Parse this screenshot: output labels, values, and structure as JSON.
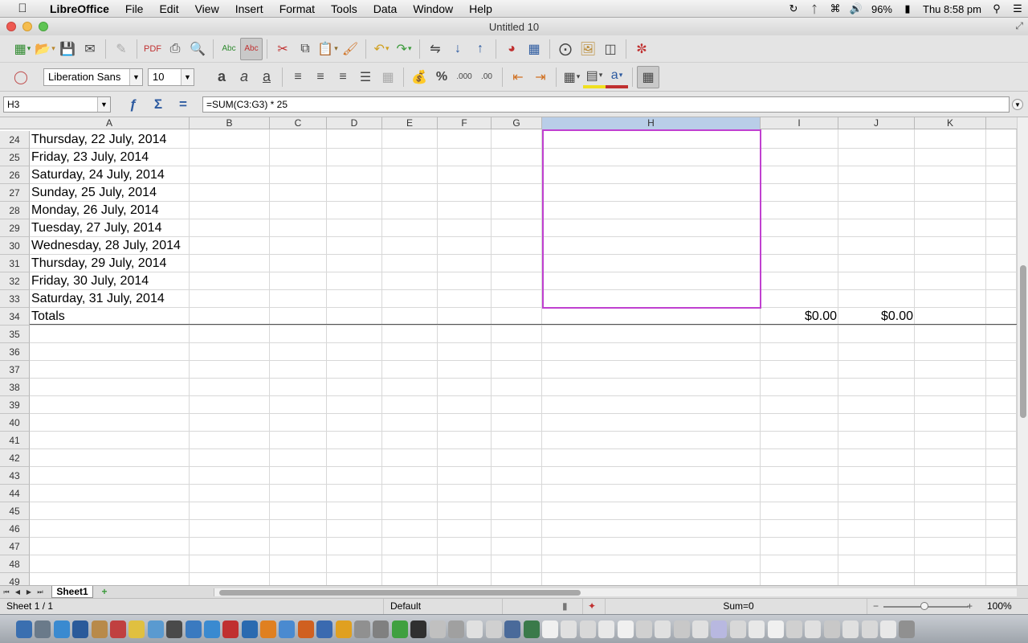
{
  "menubar": {
    "app": "LibreOffice",
    "items": [
      "File",
      "Edit",
      "View",
      "Insert",
      "Format",
      "Tools",
      "Data",
      "Window",
      "Help"
    ],
    "battery": "96%",
    "clock": "Thu 8:58 pm"
  },
  "window": {
    "title": "Untitled 10"
  },
  "toolbar": {
    "font_name": "Liberation Sans",
    "font_size": "10"
  },
  "formula": {
    "cell_ref": "H3",
    "content": "=SUM(C3:G3) * 25"
  },
  "grid": {
    "columns": [
      "A",
      "B",
      "C",
      "D",
      "E",
      "F",
      "G",
      "H",
      "I",
      "J",
      "K"
    ],
    "selected_column": "H",
    "rows": [
      {
        "num": "24",
        "a": "Thursday, 22 July, 2014"
      },
      {
        "num": "25",
        "a": "Friday, 23 July, 2014"
      },
      {
        "num": "26",
        "a": "Saturday, 24 July, 2014"
      },
      {
        "num": "27",
        "a": "Sunday, 25 July, 2014"
      },
      {
        "num": "28",
        "a": "Monday, 26 July, 2014"
      },
      {
        "num": "29",
        "a": "Tuesday, 27 July, 2014"
      },
      {
        "num": "30",
        "a": "Wednesday, 28 July, 2014"
      },
      {
        "num": "31",
        "a": "Thursday, 29 July, 2014"
      },
      {
        "num": "32",
        "a": "Friday, 30 July, 2014"
      },
      {
        "num": "33",
        "a": "Saturday, 31 July, 2014"
      },
      {
        "num": "34",
        "a": "Totals",
        "i": "$0.00",
        "j": "$0.00"
      },
      {
        "num": "35"
      },
      {
        "num": "36"
      },
      {
        "num": "37"
      },
      {
        "num": "38"
      },
      {
        "num": "39"
      },
      {
        "num": "40"
      },
      {
        "num": "41"
      },
      {
        "num": "42"
      },
      {
        "num": "43"
      },
      {
        "num": "44"
      },
      {
        "num": "45"
      },
      {
        "num": "46"
      },
      {
        "num": "47"
      },
      {
        "num": "48"
      },
      {
        "num": "49"
      }
    ]
  },
  "tabs": {
    "sheet1": "Sheet1"
  },
  "status": {
    "sheet": "Sheet 1 / 1",
    "style": "Default",
    "sum": "Sum=0",
    "zoom": "100%"
  },
  "icons": {
    "apple": "apple-logo-icon",
    "selection_color": "#c040d0",
    "column_selected_color": "#b9cee8"
  }
}
